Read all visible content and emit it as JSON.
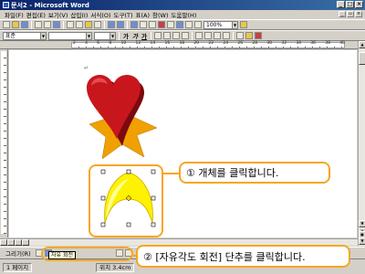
{
  "window": {
    "title": "문서2 - Microsoft Word"
  },
  "menu": {
    "items": [
      "파일(F)",
      "편집(E)",
      "보기(V)",
      "삽입(I)",
      "서식(O)",
      "도구(T)",
      "표(A)",
      "창(W)",
      "도움말(H)"
    ]
  },
  "toolbar": {
    "zoom": "100%",
    "style": "표준",
    "bold": "가",
    "italic": "가",
    "underline": "가"
  },
  "ruler": {
    "ticks": [
      "2",
      "4",
      "6",
      "8",
      "10",
      "12",
      "14",
      "16",
      "18",
      "20",
      "22",
      "24",
      "26",
      "28",
      "30",
      "32",
      "34",
      "36",
      "38",
      "40"
    ]
  },
  "drawing_toolbar": {
    "draw_label": "그리기(R)"
  },
  "tooltip": {
    "text": "자유 회전"
  },
  "statusbar": {
    "page": "1 페이지",
    "position": "위치 3.4cm"
  },
  "callouts": {
    "step1": "① 개체를 클릭합니다.",
    "step2": "② [자유각도 회전] 단추를 클릭합니다."
  },
  "colors": {
    "heart": "#c8161d",
    "star": "#f0a000",
    "moon": "#fff200",
    "accent": "#f5a623",
    "title_bar": "#0a246a"
  }
}
